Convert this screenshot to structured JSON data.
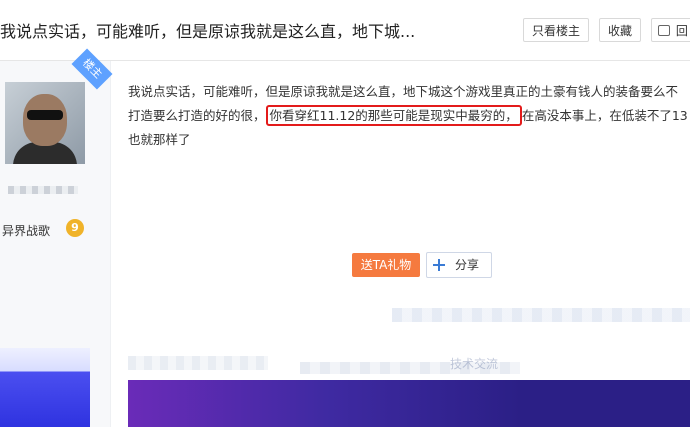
{
  "header": {
    "title": "我说点实话，可能难听，但是原谅我就是这么直，地下城...",
    "buttons": {
      "only_op": "只看楼主",
      "favorite": "收藏",
      "reply": "回"
    }
  },
  "sidebar": {
    "badge": "楼主",
    "level_name": "异界战歌",
    "level_number": "9"
  },
  "post": {
    "text_before": "我说点实话，可能难听，但是原谅我就是这么直，地下城这个游戏里真正的土豪有钱人的装备要么不打造要么打造的好的很，",
    "highlighted": "你看穿红11.12的那些可能是现实中最穷的，",
    "text_after": "在高没本事上，在低装不了13也就那样了"
  },
  "actions": {
    "gift": "送TA礼物",
    "share": "分享"
  },
  "lower": {
    "tech_text": "技术交流"
  },
  "colors": {
    "highlight_border": "#e31b1b",
    "gift_bg": "#f57a3f",
    "badge_bg": "#5ea1ff",
    "accent_blue": "#3a7bd5"
  },
  "icons": {
    "reply": "reply-icon",
    "share": "plus-icon",
    "level": "level-badge-icon"
  }
}
